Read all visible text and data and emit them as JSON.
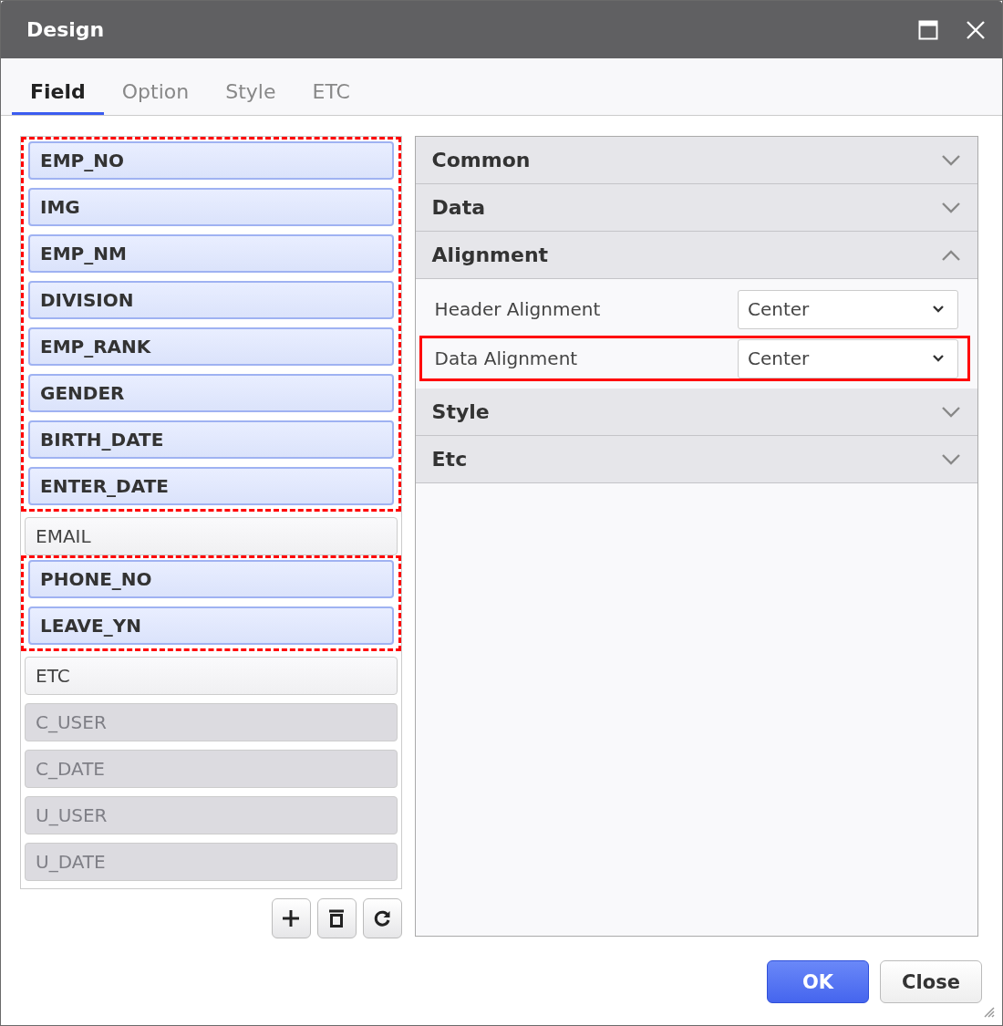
{
  "window": {
    "title": "Design"
  },
  "tabs": [
    {
      "label": "Field",
      "selected": true
    },
    {
      "label": "Option",
      "selected": false
    },
    {
      "label": "Style",
      "selected": false
    },
    {
      "label": "ETC",
      "selected": false
    }
  ],
  "fields": [
    {
      "label": "EMP_NO",
      "selected": true,
      "disabled": false
    },
    {
      "label": "IMG",
      "selected": true,
      "disabled": false
    },
    {
      "label": "EMP_NM",
      "selected": true,
      "disabled": false
    },
    {
      "label": "DIVISION",
      "selected": true,
      "disabled": false
    },
    {
      "label": "EMP_RANK",
      "selected": true,
      "disabled": false
    },
    {
      "label": "GENDER",
      "selected": true,
      "disabled": false
    },
    {
      "label": "BIRTH_DATE",
      "selected": true,
      "disabled": false
    },
    {
      "label": "ENTER_DATE",
      "selected": true,
      "disabled": false
    },
    {
      "label": "EMAIL",
      "selected": false,
      "disabled": false
    },
    {
      "label": "PHONE_NO",
      "selected": true,
      "disabled": false
    },
    {
      "label": "LEAVE_YN",
      "selected": true,
      "disabled": false
    },
    {
      "label": "ETC",
      "selected": false,
      "disabled": false
    },
    {
      "label": "C_USER",
      "selected": false,
      "disabled": true
    },
    {
      "label": "C_DATE",
      "selected": false,
      "disabled": true
    },
    {
      "label": "U_USER",
      "selected": false,
      "disabled": true
    },
    {
      "label": "U_DATE",
      "selected": false,
      "disabled": true
    }
  ],
  "sections": [
    {
      "title": "Common",
      "expanded": false
    },
    {
      "title": "Data",
      "expanded": false
    },
    {
      "title": "Alignment",
      "expanded": true,
      "properties": [
        {
          "label": "Header Alignment",
          "value": "Center",
          "highlighted": false
        },
        {
          "label": "Data Alignment",
          "value": "Center",
          "highlighted": true
        }
      ]
    },
    {
      "title": "Style",
      "expanded": false
    },
    {
      "title": "Etc",
      "expanded": false
    }
  ],
  "buttons": [
    {
      "label": "OK",
      "kind": "primary"
    },
    {
      "label": "Close",
      "kind": "secondary"
    }
  ]
}
